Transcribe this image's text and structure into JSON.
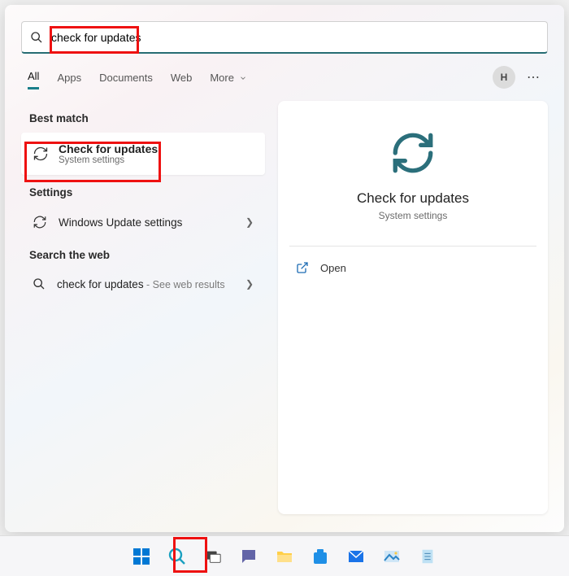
{
  "search": {
    "query": "check for updates"
  },
  "tabs": {
    "items": [
      "All",
      "Apps",
      "Documents",
      "Web",
      "More"
    ],
    "active_index": 0,
    "avatar_letter": "H"
  },
  "left": {
    "best_match_header": "Best match",
    "best_match": {
      "title": "Check for updates",
      "subtitle": "System settings"
    },
    "settings_header": "Settings",
    "settings_item": "Windows Update settings",
    "web_header": "Search the web",
    "web_item_query": "check for updates",
    "web_item_suffix": " - See web results"
  },
  "detail": {
    "title": "Check for updates",
    "subtitle": "System settings",
    "open_label": "Open"
  },
  "taskbar": {
    "items": [
      "start",
      "search",
      "taskview",
      "chat",
      "explorer",
      "store",
      "mail",
      "photos",
      "notepad"
    ]
  }
}
